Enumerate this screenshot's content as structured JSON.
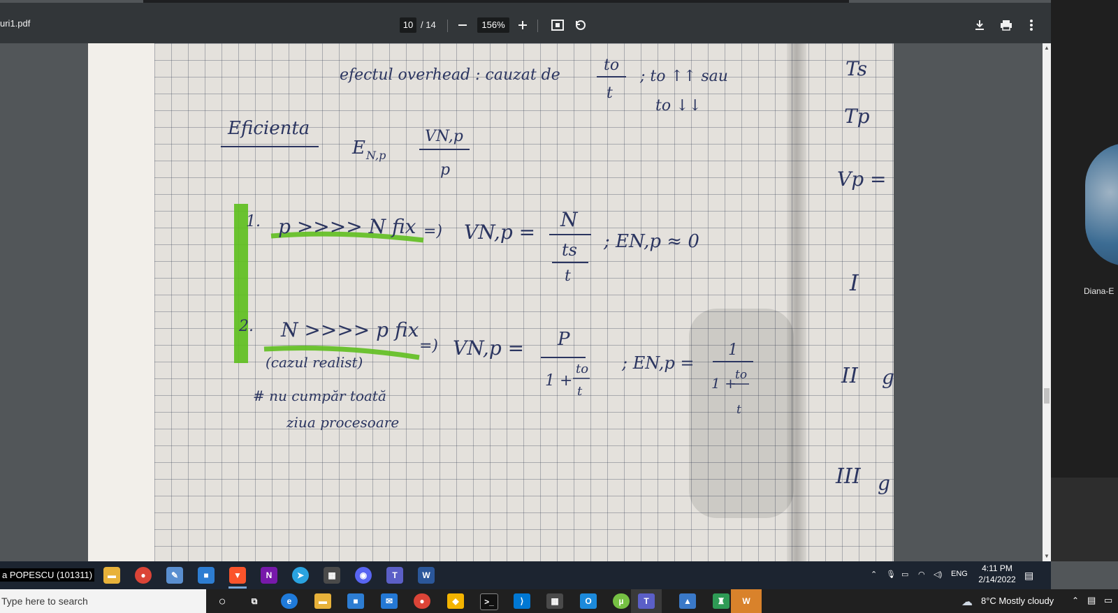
{
  "viewer": {
    "filename": "uri1.pdf",
    "current_page": "10",
    "page_total": "/ 14",
    "zoom": "156%",
    "icons": [
      "zoom-out-icon",
      "zoom-in-icon",
      "fit-page-icon",
      "rotate-icon",
      "download-icon",
      "print-icon",
      "more-icon"
    ]
  },
  "notes": {
    "line1": "efectul overhead : cauzat de",
    "line1_frac_num": "to",
    "line1_frac_den": "t",
    "line1_tail": "; to ↑↑ sau",
    "line1_tail2": "to ↓↓",
    "heading": "Eficienta",
    "eff_lhs": "E",
    "eff_sub": "N,p",
    "eff_num": "VN,p",
    "eff_den": "p",
    "item1_label": "1.",
    "item1_text": "p >>>> N fix",
    "item1_arrow": "=)",
    "item1_lhs": "VN,p =",
    "item1_num": "N",
    "item1_mid": "ts",
    "item1_den": "t",
    "item1_tail": "; EN,p ≈ 0",
    "item2_label": "2.",
    "item2_text": "N >>>> p fix",
    "item2_arrow": "=)",
    "item2_sub": "(cazul realist)",
    "item2_lhs": "VN,p =",
    "item2_num": "P",
    "item2_den_a": "1 +",
    "item2_den_frac_num": "to",
    "item2_den_frac_den": "t",
    "item2_tail": "; EN,p =",
    "item2_tail_num": "1",
    "item2_tail_den_a": "1 +",
    "item2_tail_den_num": "to",
    "item2_tail_den_den": "t",
    "note_line1": "# nu cumpăr toată",
    "note_line2": "ziua procesoare",
    "right_ts": "Ts",
    "right_tp": "Tp",
    "right_vp": "Vp =",
    "right_i": "I",
    "right_ii": "II",
    "right_ii_tail": "g",
    "right_iii": "III",
    "right_iii_tail": "g"
  },
  "meeting": {
    "participant_name": "Diana-E"
  },
  "taskbar_top": {
    "user_label": "a POPESCU (101311)",
    "lang": "ENG",
    "time": "4:11 PM",
    "date": "2/14/2022",
    "apps": [
      "file-explorer",
      "chrome",
      "paint",
      "store",
      "brave",
      "onenote",
      "telegram",
      "calculator",
      "discord",
      "teams",
      "word"
    ]
  },
  "taskbar_bottom": {
    "search_placeholder": "Type here to search",
    "weather": "8°C  Mostly cloudy"
  },
  "colors": {
    "toolbar_bg": "#323639",
    "highlighter": "#5fbf1f",
    "ink": "#2b3560"
  }
}
